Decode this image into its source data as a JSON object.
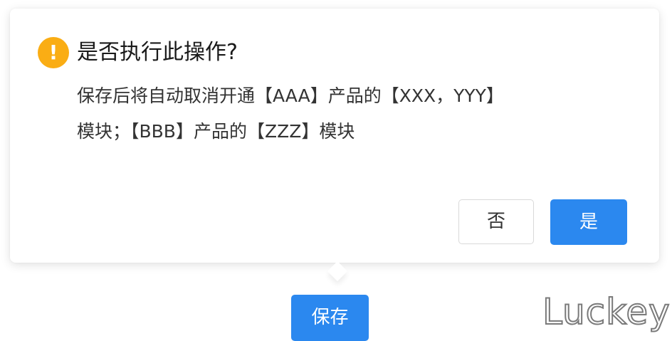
{
  "dialog": {
    "title": "是否执行此操作?",
    "message_line1": "保存后将自动取消开通【AAA】产品的【XXX，YYY】",
    "message_line2": "模块；【BBB】产品的【ZZZ】模块",
    "no_label": "否",
    "yes_label": "是",
    "icon": "exclamation-icon",
    "icon_glyph": "!"
  },
  "page": {
    "save_label": "保存"
  },
  "watermark": {
    "text": "Luckey"
  },
  "colors": {
    "primary": "#2b88ef",
    "warning": "#faad14"
  }
}
